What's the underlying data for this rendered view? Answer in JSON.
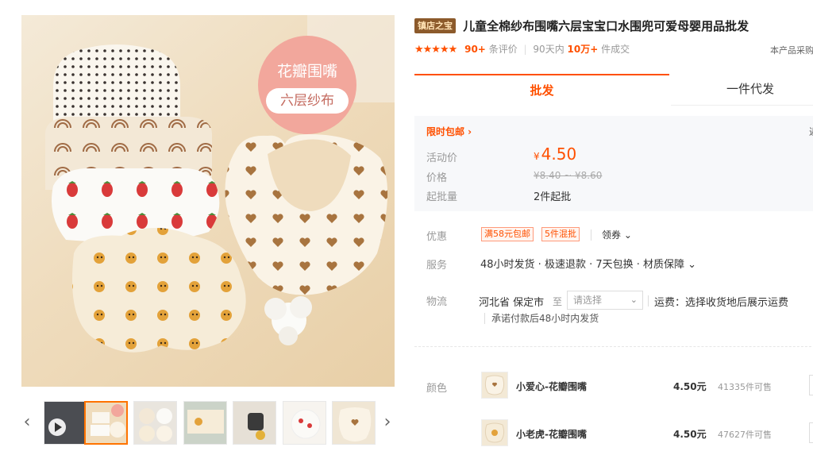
{
  "gallery": {
    "badge_line1": "花瓣围嘴",
    "badge_line2": "六层纱布",
    "prev_icon": "‹",
    "next_icon": "›",
    "thumbnails": [
      "video",
      "bibs-set",
      "bibs-flat",
      "bibs-hanging",
      "watch-and-bib",
      "strawberry-bibs",
      "heart-bib"
    ],
    "active_thumbnail": 1
  },
  "product": {
    "shop_tag": "镇店之宝",
    "title": "儿童全棉纱布围嘴六层宝宝口水围兜可爱母婴用品批发",
    "stars": "★★★★★",
    "reviews_count": "90+",
    "reviews_label": "条评价",
    "sales_prefix": "90天内",
    "sales_count": "10万+",
    "sales_suffix": "件成交",
    "right_note": "本产品采购"
  },
  "tabs": {
    "wholesale": "批发",
    "dropship": "一件代发"
  },
  "price_box": {
    "promo": "限时包邮 ›",
    "promo_right": "返",
    "activity_label": "活动价",
    "currency": "¥",
    "activity_price": "4.50",
    "price_label": "价格",
    "price_range": "¥8.40 ~ ¥8.60",
    "moq_label": "起批量",
    "moq_value": "2件起批"
  },
  "offers": {
    "label": "优惠",
    "coupon1": "满58元包邮",
    "coupon2": "5件混批",
    "claim": "领券 ⌄"
  },
  "service": {
    "label": "服务",
    "text": "48小时发货 · 极速退款 · 7天包换 · 材质保障 ⌄"
  },
  "logistics": {
    "label": "物流",
    "from": "河北省 保定市",
    "to": "至",
    "select_placeholder": "请选择",
    "chevron": "⌄",
    "freight": "运费：选择收货地后展示运费",
    "promise": "承诺付款后48小时内发货"
  },
  "sku": {
    "label": "颜色",
    "items": [
      {
        "name": "小爱心-花瓣围嘴",
        "price": "4.50元",
        "stock": "41335件可售"
      },
      {
        "name": "小老虎-花瓣围嘴",
        "price": "4.50元",
        "stock": "47627件可售"
      }
    ]
  },
  "colors": {
    "accent": "#ff5000",
    "badge": "#f2a79c",
    "shop_tag_bg": "#8c5a2b"
  }
}
